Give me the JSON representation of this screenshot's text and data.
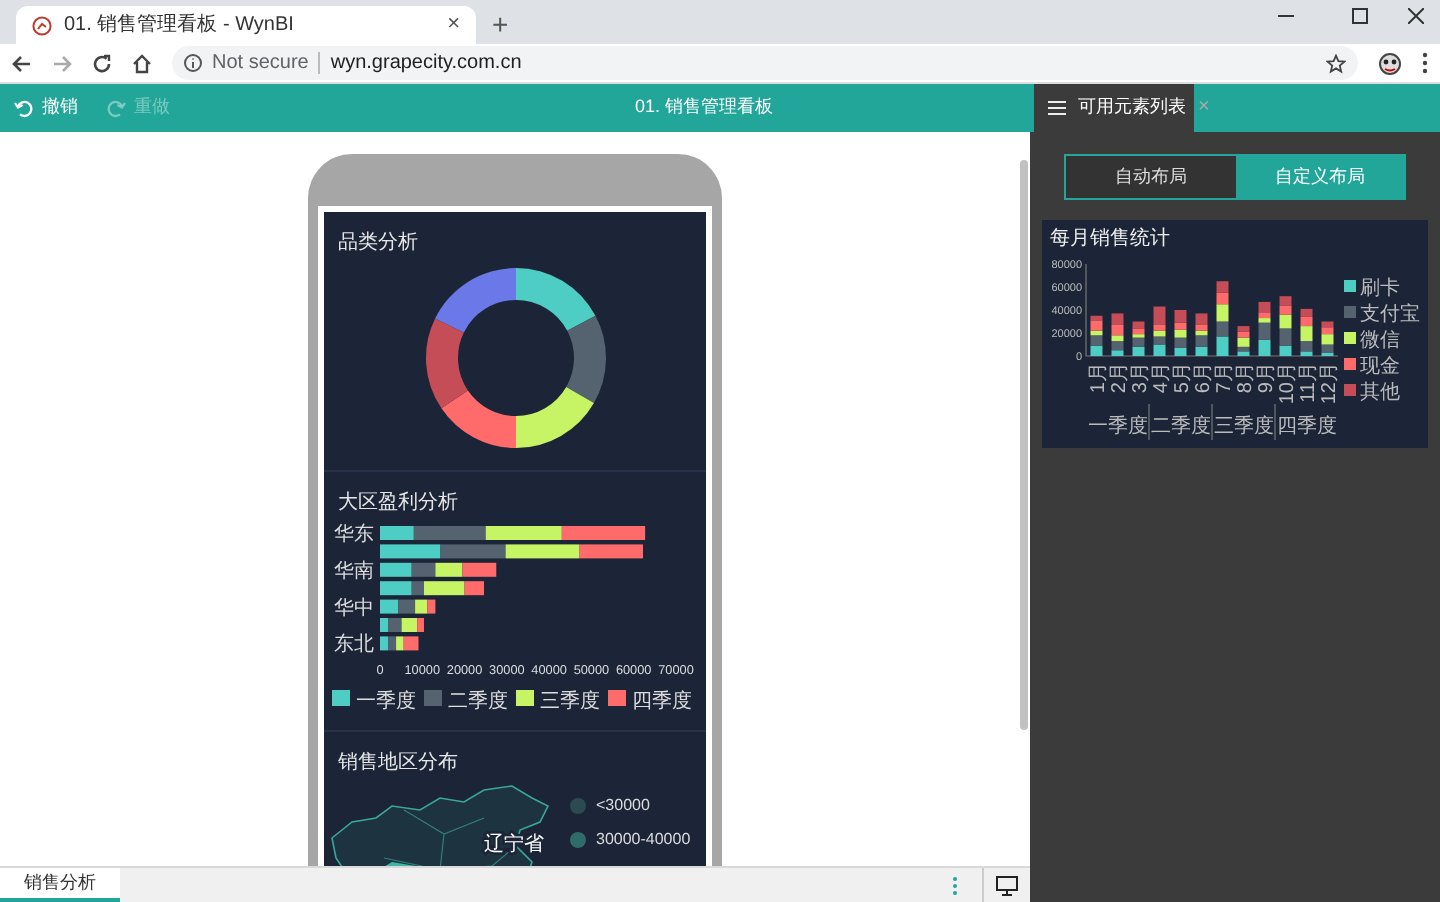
{
  "browser": {
    "tab": {
      "title": "01. 销售管理看板 - WynBI",
      "close": "×"
    },
    "new_tab": "+",
    "address": {
      "security": "Not secure",
      "url": "wyn.grapecity.com.cn"
    }
  },
  "toolbar": {
    "actions": [
      {
        "label": "撤销",
        "disabled": false
      },
      {
        "label": "重做",
        "disabled": true
      }
    ],
    "title": "01. 销售管理看板"
  },
  "canvas": {
    "sections": [
      {
        "kind": "donut",
        "title": "品类分析"
      },
      {
        "kind": "bar",
        "title": "大区盈利分析",
        "chart_data": {
          "type": "bar",
          "orientation": "horizontal",
          "stacked": true,
          "legend": "bottom",
          "categories": [
            "华东",
            null,
            "华南",
            null,
            "华中",
            null,
            "东北"
          ],
          "xlim": [
            0,
            70000
          ],
          "xticks": [
            0,
            10000,
            20000,
            30000,
            40000,
            50000,
            60000,
            70000
          ],
          "series": [
            {
              "name": "一季度",
              "color": "#4ecdc4",
              "values": [
                8000,
                14300,
                7500,
                7500,
                4300,
                1900,
                1900
              ]
            },
            {
              "name": "二季度",
              "color": "#556270",
              "values": [
                17000,
                15400,
                5600,
                2900,
                4000,
                3200,
                1900
              ]
            },
            {
              "name": "三季度",
              "color": "#c7f464",
              "values": [
                18000,
                17500,
                6400,
                9600,
                2900,
                3700,
                1800
              ]
            },
            {
              "name": "四季度",
              "color": "#ff6b6b",
              "values": [
                19700,
                15000,
                8000,
                4600,
                1900,
                1600,
                3500
              ]
            }
          ]
        }
      },
      {
        "kind": "map",
        "title": "销售地区分布",
        "map_labels": [
          "辽宁省"
        ],
        "legend": [
          {
            "label": "<30000",
            "color": "#2b4a52"
          },
          {
            "label": "30000-40000",
            "color": "#2f6b6b"
          }
        ]
      }
    ]
  },
  "panel": {
    "title": "可用元素列表",
    "close": "×",
    "layout_tabs": [
      {
        "label": "自动布局",
        "selected": false
      },
      {
        "label": "自定义布局",
        "selected": true
      }
    ],
    "element_card": {
      "x_groups": [
        "一季度",
        "二季度",
        "三季度",
        "四季度"
      ],
      "chart_data": {
        "type": "bar",
        "stacked": true,
        "legend": "right",
        "title": "每月销售统计",
        "categories": [
          "1月",
          "2月",
          "3月",
          "4月",
          "5月",
          "6月",
          "7月",
          "8月",
          "9月",
          "10月",
          "11月",
          "12月"
        ],
        "ylim": [
          0,
          80000
        ],
        "yticks": [
          0,
          20000,
          40000,
          60000,
          80000
        ],
        "series": [
          {
            "name": "刷卡",
            "color": "#4ecdc4",
            "values": [
              9000,
              5000,
              8000,
              10000,
              7000,
              8000,
              17000,
              4000,
              14000,
              9000,
              4000,
              3000
            ]
          },
          {
            "name": "支付宝",
            "color": "#556270",
            "values": [
              9000,
              8000,
              8000,
              7000,
              9000,
              10000,
              13000,
              4000,
              15000,
              15000,
              9000,
              7000
            ]
          },
          {
            "name": "微信",
            "color": "#c7f464",
            "values": [
              4000,
              5000,
              3000,
              5000,
              7000,
              4000,
              15000,
              8000,
              4000,
              12000,
              13000,
              9000
            ]
          },
          {
            "name": "现金",
            "color": "#ff6b6b",
            "values": [
              9000,
              9000,
              5000,
              5000,
              6000,
              5000,
              10000,
              5000,
              5000,
              8000,
              8000,
              6000
            ]
          },
          {
            "name": "其他",
            "color": "#c44d58",
            "values": [
              4000,
              10000,
              6000,
              16000,
              11000,
              10000,
              10000,
              5000,
              9000,
              8000,
              7000,
              5000
            ]
          }
        ]
      }
    }
  },
  "sheet_tabs": [
    {
      "label": "销售分析",
      "selected": true
    }
  ]
}
